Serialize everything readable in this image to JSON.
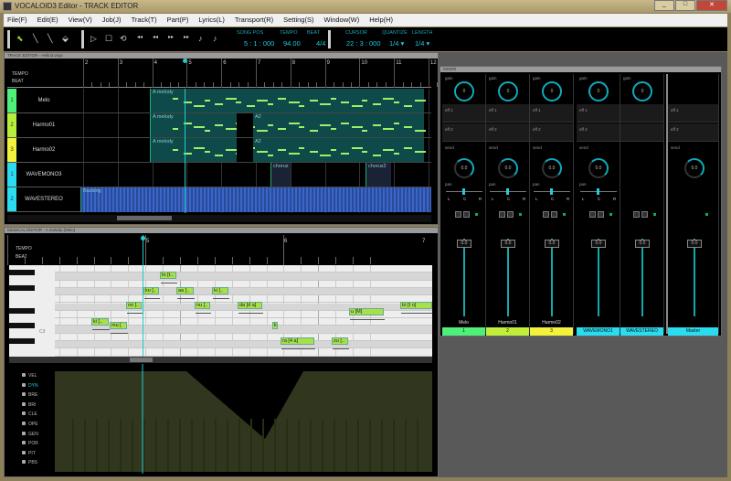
{
  "window": {
    "title": "VOCALOID3 Editor - TRACK EDITOR",
    "buttons": [
      "_",
      "□",
      "✕"
    ]
  },
  "menu": [
    "File(F)",
    "Edit(E)",
    "View(V)",
    "Job(J)",
    "Track(T)",
    "Part(P)",
    "Lyrics(L)",
    "Transport(R)",
    "Setting(S)",
    "Window(W)",
    "Help(H)"
  ],
  "toolbar": {
    "song_pos_label": "SONG POS",
    "song_pos": "5 : 1 : 000",
    "tempo_label": "TEMPO",
    "tempo": "94.00",
    "beat_label": "BEAT",
    "beat": "4/4",
    "cursor_label": "CURSOR",
    "cursor": "22 : 3 : 000",
    "quantize_label": "QUANTIZE",
    "quantize": "1/4 ▾",
    "length_label": "LENGTH",
    "length": "1/4 ▾"
  },
  "track_editor": {
    "title": "TRACK EDITOR - Hello3.vsqx",
    "tempo_label": "TEMPO",
    "beat_label": "BEAT",
    "bars": [
      "2",
      "3",
      "4",
      "5",
      "6",
      "7",
      "8",
      "9",
      "10",
      "11",
      "12"
    ],
    "tracks": [
      {
        "num": "1",
        "name": "Melo",
        "color": "#4ff07a"
      },
      {
        "num": "2",
        "name": "Harmo01",
        "color": "#b6ee3a"
      },
      {
        "num": "3",
        "name": "Harmo02",
        "color": "#f2f23a"
      },
      {
        "num": "1",
        "name": "WAVEMONO3",
        "color": "#2adcf0"
      },
      {
        "num": "2",
        "name": "WAVESTEREO",
        "color": "#2adcf0"
      }
    ],
    "parts": {
      "melody": "A melody",
      "a2": "A2",
      "chorus": "chorus",
      "chorus2": "chorus2",
      "wave_stereo": "Backing"
    }
  },
  "musical_editor": {
    "title": "MUSICAL EDITOR - A melody (Melo)",
    "tempo_label": "TEMPO",
    "beat_label": "BEAT",
    "bars": [
      "5",
      "6",
      "7"
    ],
    "c3_label": "C3",
    "notes": [
      "ki [..",
      "mu [",
      "no [..",
      "ko [..",
      "to [t..",
      "aa [..",
      "nu [..",
      "ki [..",
      "da [d a]",
      "k..",
      "ra [4 a]",
      "zu [..",
      "u [M]",
      "to [t o]"
    ]
  },
  "control_track": {
    "params": [
      "VEL",
      "DYN",
      "BRE",
      "BRI",
      "CLE",
      "OPE",
      "GEN",
      "POR",
      "PIT",
      "PBS"
    ],
    "selected": "DYN"
  },
  "mixer": {
    "title": "MIXER",
    "gain_label": "gain",
    "eff1_label": "eff 1",
    "eff2_label": "eff 2",
    "send_label": "send",
    "pan_label": "pan",
    "pan_marks": [
      "L",
      "C",
      "R"
    ],
    "strips": [
      {
        "name": "Melo",
        "tag": "1",
        "color": "#4ff07a",
        "gain": "0",
        "level": "0.0",
        "pan": "0.0"
      },
      {
        "name": "Harmo01",
        "tag": "2",
        "color": "#c0ee3a",
        "gain": "0",
        "level": "0.0",
        "pan": "0.0"
      },
      {
        "name": "Harmo02",
        "tag": "3",
        "color": "#f2f23a",
        "gain": "0",
        "level": "0.0",
        "pan": "0.0"
      },
      {
        "name": "",
        "tag": "WAVEMONO1",
        "color": "#2adcf0",
        "gain": "0",
        "level": "0.0",
        "pan": "0.0"
      },
      {
        "name": "",
        "tag": "WAVESTEREO",
        "color": "#2adcf0",
        "gain": "0",
        "level": "0.0",
        "pan": ""
      },
      {
        "name": "",
        "tag": "Master",
        "color": "#2adcf0",
        "gain": "",
        "level": "0.0",
        "pan": "0.0"
      }
    ]
  }
}
